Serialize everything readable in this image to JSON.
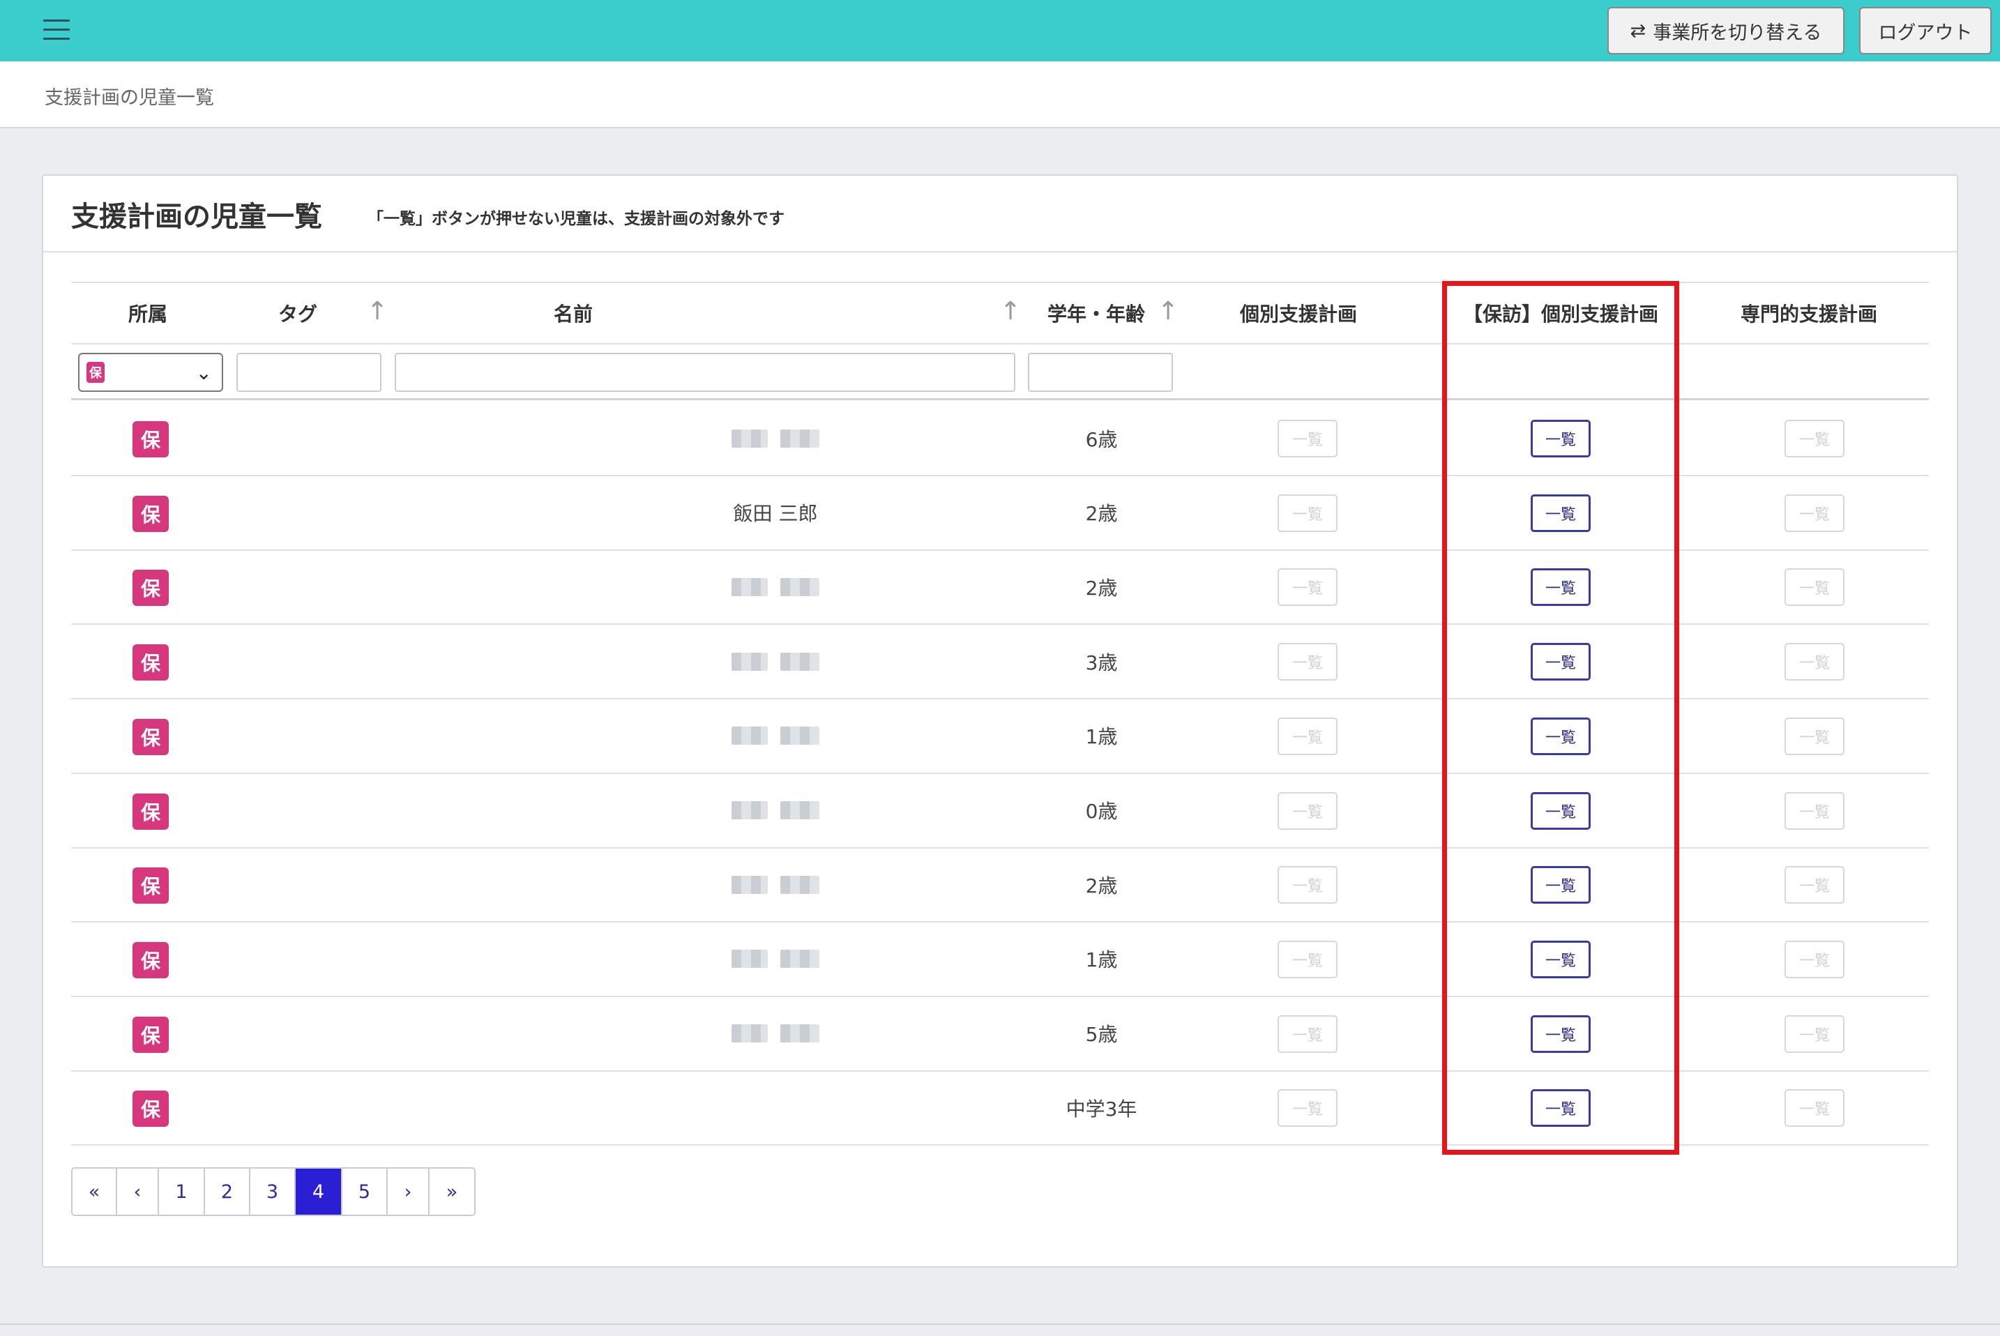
{
  "header": {
    "switch_label": "事業所を切り替える",
    "logout_label": "ログアウト"
  },
  "breadcrumb": "支援計画の児童一覧",
  "card": {
    "title": "支援計画の児童一覧",
    "note": "「一覧」ボタンが押せない児童は、支援計画の対象外です"
  },
  "columns": {
    "affiliation": "所属",
    "tag": "タグ",
    "name": "名前",
    "grade_age": "学年・年齢",
    "individual_plan": "個別支援計画",
    "visit_plan": "【保訪】個別支援計画",
    "specialized_plan": "専門的支援計画"
  },
  "filter": {
    "affiliation_selected": "保"
  },
  "list_button_label": "一覧",
  "rows": [
    {
      "badge": "保",
      "name": "",
      "age": "6歳"
    },
    {
      "badge": "保",
      "name": "飯田 三郎",
      "age": "2歳"
    },
    {
      "badge": "保",
      "name": "",
      "age": "2歳"
    },
    {
      "badge": "保",
      "name": "",
      "age": "3歳"
    },
    {
      "badge": "保",
      "name": "",
      "age": "1歳"
    },
    {
      "badge": "保",
      "name": "",
      "age": "0歳"
    },
    {
      "badge": "保",
      "name": "",
      "age": "2歳"
    },
    {
      "badge": "保",
      "name": "",
      "age": "1歳"
    },
    {
      "badge": "保",
      "name": "",
      "age": "5歳"
    },
    {
      "badge": "保",
      "name": "",
      "age": "中学3年"
    }
  ],
  "pagination": {
    "first": "«",
    "prev": "‹",
    "pages": [
      "1",
      "2",
      "3",
      "4",
      "5"
    ],
    "current": "4",
    "next": "›",
    "last": "»"
  },
  "colors": {
    "topbar": "#3bcccc",
    "badge": "#d6377d",
    "active_button": "#3b3aa0",
    "current_page": "#2b1fd6",
    "highlight": "#e8141c"
  }
}
